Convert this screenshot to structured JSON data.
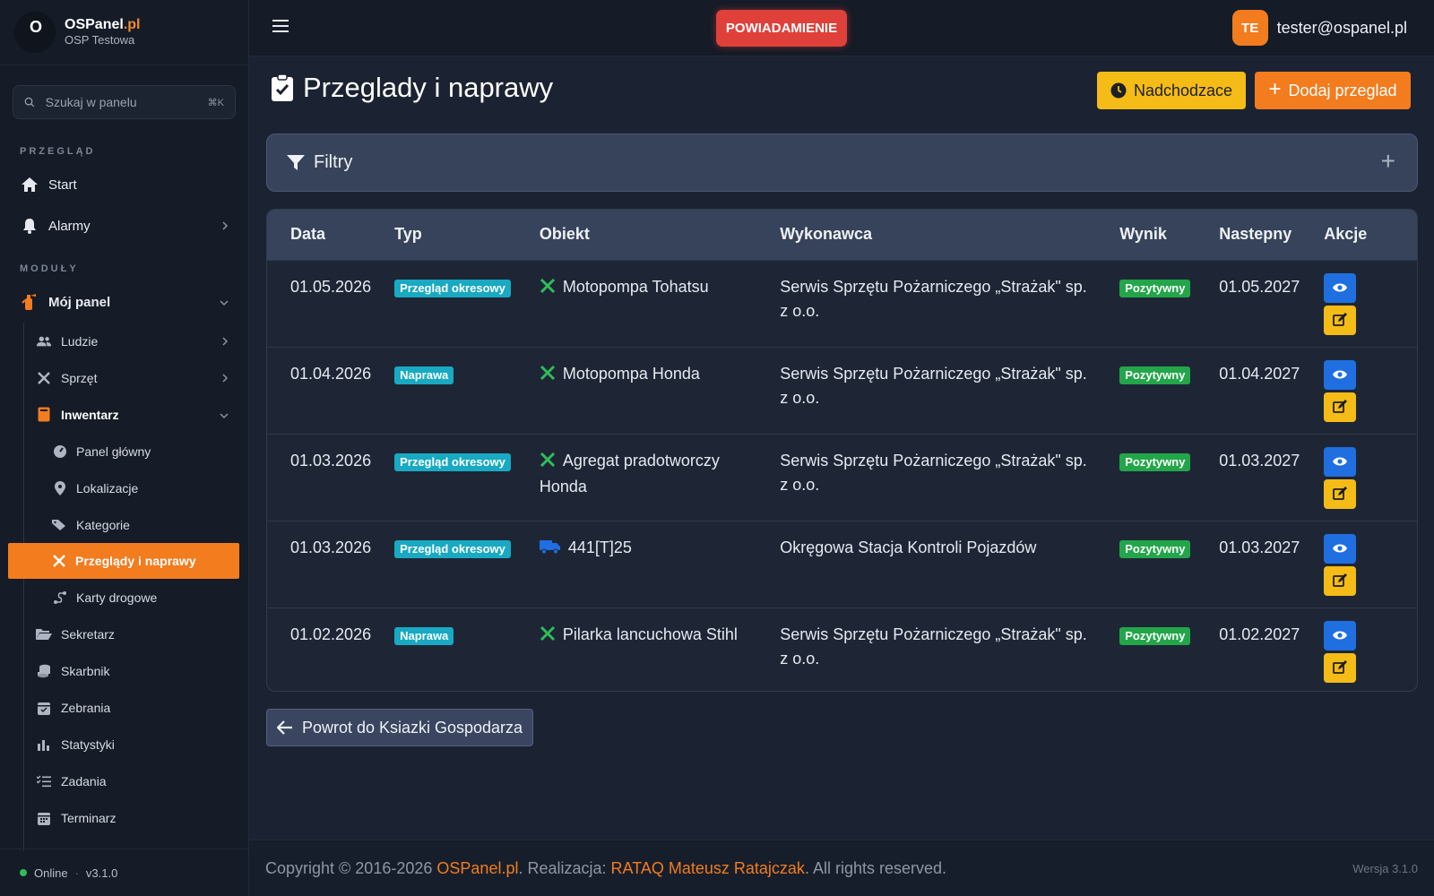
{
  "brand": {
    "name": "OSPanel",
    "tld": ".pl",
    "subtitle": "OSP Testowa",
    "logo_text": "O"
  },
  "search": {
    "placeholder": "Szukaj w panelu",
    "shortcut": "⌘K"
  },
  "sidebar": {
    "section_overview": "PRZEGLĄD",
    "section_modules": "MODUŁY",
    "start": "Start",
    "alarms": "Alarmy",
    "my_panel": "Mój panel",
    "people": "Ludzie",
    "equipment": "Sprzęt",
    "inventory": "Inwentarz",
    "inventory_children": [
      "Panel główny",
      "Lokalizacje",
      "Kategorie",
      "Przeglądy i naprawy",
      "Karty drogowe"
    ],
    "secretary": "Sekretarz",
    "treasurer": "Skarbnik",
    "meetings": "Zebrania",
    "statistics": "Statystyki",
    "tasks": "Zadania",
    "schedule": "Terminarz",
    "status": "Online",
    "version": "v3.1.0"
  },
  "topbar": {
    "notification": "POWIADAMIENIE",
    "avatar_initials": "TE",
    "user_email": "tester@ospanel.pl"
  },
  "page": {
    "title": "Przeglady i naprawy",
    "upcoming_button": "Nadchodzace",
    "add_button": "Dodaj przeglad",
    "filters_label": "Filtry",
    "filters_toggle": "+",
    "back_button": "Powrot do Ksiazki Gospodarza"
  },
  "table": {
    "headers": [
      "Data",
      "Typ",
      "Obiekt",
      "Wykonawca",
      "Wynik",
      "Nastepny",
      "Akcje"
    ],
    "rows": [
      {
        "date": "01.05.2026",
        "type": "Przegląd okresowy",
        "object": "Motopompa Tohatsu",
        "object_icon": "tools-icon",
        "contractor": "Serwis Sprzętu Pożarniczego „Strażak\" sp. z o.o.",
        "result": "Pozytywny",
        "next": "01.05.2027"
      },
      {
        "date": "01.04.2026",
        "type": "Naprawa",
        "object": "Motopompa Honda",
        "object_icon": "tools-icon",
        "contractor": "Serwis Sprzętu Pożarniczego „Strażak\" sp. z o.o.",
        "result": "Pozytywny",
        "next": "01.04.2027"
      },
      {
        "date": "01.03.2026",
        "type": "Przegląd okresowy",
        "object": "Agregat pradotworczy Honda",
        "object_icon": "tools-icon",
        "contractor": "Serwis Sprzętu Pożarniczego „Strażak\" sp. z o.o.",
        "result": "Pozytywny",
        "next": "01.03.2027"
      },
      {
        "date": "01.03.2026",
        "type": "Przegląd okresowy",
        "object": "441[T]25",
        "object_icon": "truck-icon",
        "contractor": "Okręgowa Stacja Kontroli Pojazdów",
        "result": "Pozytywny",
        "next": "01.03.2027"
      },
      {
        "date": "01.02.2026",
        "type": "Naprawa",
        "object": "Pilarka lancuchowa Stihl",
        "object_icon": "tools-icon",
        "contractor": "Serwis Sprzętu Pożarniczego „Strażak\" sp. z o.o.",
        "result": "Pozytywny",
        "next": "01.02.2027"
      }
    ]
  },
  "footer": {
    "copyright_prefix": "Copyright © 2016-2026 ",
    "brand_link": "OSPanel.pl",
    "realization_prefix": ". Realizacja: ",
    "author_link": "RATAQ Mateusz Ratajczak",
    "suffix": ". All rights reserved.",
    "version": "Wersja 3.1.0"
  },
  "colors": {
    "accent": "#f27c1e",
    "notify": "#e0403a",
    "warning": "#f5bb16",
    "info": "#19a9c2",
    "success": "#23a64a",
    "primary": "#1f6fe0"
  }
}
